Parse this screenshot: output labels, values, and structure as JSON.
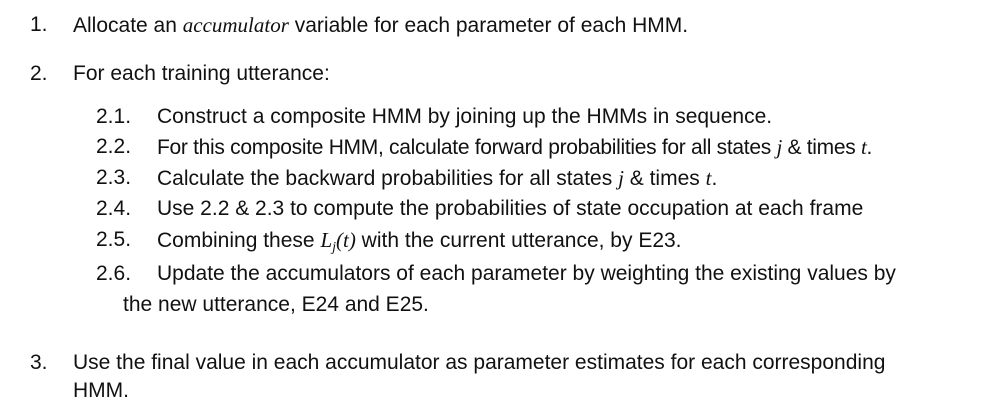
{
  "list": {
    "item1": {
      "number": "1.",
      "text_before": "Allocate an ",
      "emphasis": "accumulator",
      "text_after": " variable for each parameter of each HMM."
    },
    "item2": {
      "number": "2.",
      "text": "For each training utterance:",
      "sub": [
        {
          "number": "2.1.",
          "text": "Construct a composite HMM by joining up the HMMs in sequence."
        },
        {
          "number": "2.2.",
          "text_before": "For this composite HMM, calculate forward probabilities for all states ",
          "var1": "j",
          "mid": " & times ",
          "var2": "t",
          "end": "."
        },
        {
          "number": "2.3.",
          "text_before": "Calculate the backward probabilities for all states ",
          "var1": "j",
          "mid": " & times ",
          "var2": "t",
          "end": "."
        },
        {
          "number": "2.4.",
          "text": "Use 2.2 & 2.3 to compute the probabilities of state occupation at each frame"
        },
        {
          "number": "2.5.",
          "text_before": "Combining these ",
          "math_L": "L",
          "math_sub": "j",
          "math_arg": "(t)",
          "text_after": " with the current utterance, by E23."
        },
        {
          "number": "2.6.",
          "text": "Update the accumulators of each parameter by weighting the existing values by",
          "continuation": "the new utterance, E24 and E25."
        }
      ]
    },
    "item3": {
      "number": "3.",
      "text": "Use the final value in each accumulator as parameter estimates for each corresponding",
      "continuation": "HMM."
    }
  }
}
